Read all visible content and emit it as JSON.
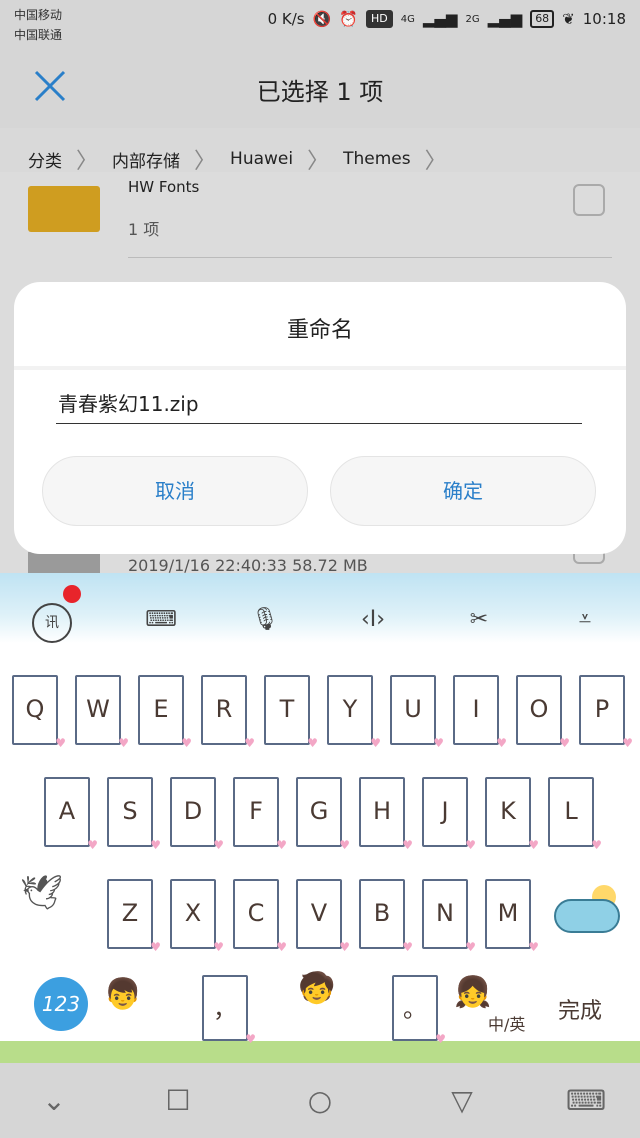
{
  "status_bar": {
    "carrier1": "中国移动",
    "carrier2": "中国联通",
    "net_speed": "0 K/s",
    "hd": "HD",
    "sig1": "4G",
    "sig2": "2G",
    "battery": "68",
    "time": "10:18"
  },
  "app_bar": {
    "title": "已选择 1 项"
  },
  "breadcrumb": [
    "分类",
    "内部存储",
    "Huawei",
    "Themes"
  ],
  "list": {
    "item1_name": "HW Fonts",
    "item1_meta": "1 项",
    "item2_meta": "2019/1/16 22:40:33 58.72 MB"
  },
  "dialog": {
    "title": "重命名",
    "value": "青春紫幻11.zip",
    "cancel": "取消",
    "confirm": "确定"
  },
  "keyboard": {
    "toolbar": [
      "xunfei-icon",
      "keyboard-icon",
      "mic-icon",
      "cursor-icon",
      "cut-icon",
      "collapse-icon"
    ],
    "row1": [
      "Q",
      "W",
      "E",
      "R",
      "T",
      "Y",
      "U",
      "I",
      "O",
      "P"
    ],
    "row2": [
      "A",
      "S",
      "D",
      "F",
      "G",
      "H",
      "J",
      "K",
      "L"
    ],
    "row3": [
      "Z",
      "X",
      "C",
      "V",
      "B",
      "N",
      "M"
    ],
    "num_key": "123",
    "comma": "，",
    "period": "。",
    "lang": "中/英",
    "done": "完成"
  },
  "nav_bar": [
    "back-icon",
    "recent-icon",
    "home-icon",
    "triangle-icon",
    "keyboard-icon"
  ]
}
